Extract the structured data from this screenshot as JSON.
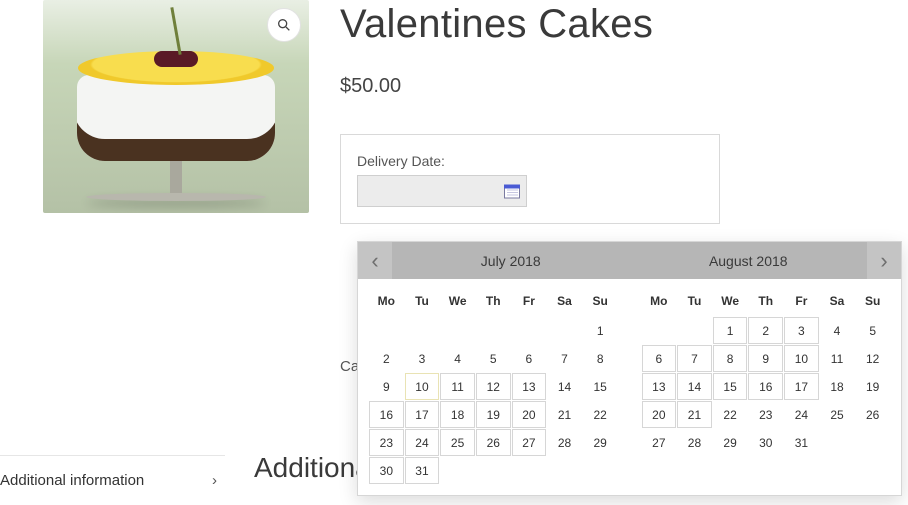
{
  "product": {
    "title": "Valentines Cakes",
    "price": "$50.00"
  },
  "sidebar_tab": {
    "label": "Additional information"
  },
  "category_label": "Cat",
  "additional_heading": "Additional",
  "delivery": {
    "label": "Delivery Date:",
    "value": ""
  },
  "calendar": {
    "months": [
      {
        "title": "July 2018",
        "headers": [
          "Mo",
          "Tu",
          "We",
          "Th",
          "Fr",
          "Sa",
          "Su"
        ],
        "weeks": [
          [
            null,
            null,
            null,
            null,
            null,
            null,
            {
              "d": 1,
              "state": "dis"
            }
          ],
          [
            {
              "d": 2,
              "state": "dis"
            },
            {
              "d": 3,
              "state": "dis"
            },
            {
              "d": 4,
              "state": "dis"
            },
            {
              "d": 5,
              "state": "dis"
            },
            {
              "d": 6,
              "state": "dis"
            },
            {
              "d": 7,
              "state": "dis"
            },
            {
              "d": 8,
              "state": "dis"
            }
          ],
          [
            {
              "d": 9,
              "state": "dis"
            },
            {
              "d": 10,
              "state": "today"
            },
            {
              "d": 11,
              "state": "avail"
            },
            {
              "d": 12,
              "state": "avail"
            },
            {
              "d": 13,
              "state": "avail"
            },
            {
              "d": 14,
              "state": "dis"
            },
            {
              "d": 15,
              "state": "dis"
            }
          ],
          [
            {
              "d": 16,
              "state": "avail"
            },
            {
              "d": 17,
              "state": "avail"
            },
            {
              "d": 18,
              "state": "avail"
            },
            {
              "d": 19,
              "state": "avail"
            },
            {
              "d": 20,
              "state": "avail"
            },
            {
              "d": 21,
              "state": "dis"
            },
            {
              "d": 22,
              "state": "dis"
            }
          ],
          [
            {
              "d": 23,
              "state": "avail"
            },
            {
              "d": 24,
              "state": "avail"
            },
            {
              "d": 25,
              "state": "avail"
            },
            {
              "d": 26,
              "state": "avail"
            },
            {
              "d": 27,
              "state": "avail"
            },
            {
              "d": 28,
              "state": "dis"
            },
            {
              "d": 29,
              "state": "dis"
            }
          ],
          [
            {
              "d": 30,
              "state": "avail"
            },
            {
              "d": 31,
              "state": "avail"
            },
            null,
            null,
            null,
            null,
            null
          ]
        ]
      },
      {
        "title": "August 2018",
        "headers": [
          "Mo",
          "Tu",
          "We",
          "Th",
          "Fr",
          "Sa",
          "Su"
        ],
        "weeks": [
          [
            null,
            null,
            {
              "d": 1,
              "state": "avail"
            },
            {
              "d": 2,
              "state": "avail"
            },
            {
              "d": 3,
              "state": "avail"
            },
            {
              "d": 4,
              "state": "dis"
            },
            {
              "d": 5,
              "state": "dis"
            }
          ],
          [
            {
              "d": 6,
              "state": "avail"
            },
            {
              "d": 7,
              "state": "avail"
            },
            {
              "d": 8,
              "state": "avail"
            },
            {
              "d": 9,
              "state": "avail"
            },
            {
              "d": 10,
              "state": "avail"
            },
            {
              "d": 11,
              "state": "dis"
            },
            {
              "d": 12,
              "state": "dis"
            }
          ],
          [
            {
              "d": 13,
              "state": "avail"
            },
            {
              "d": 14,
              "state": "avail"
            },
            {
              "d": 15,
              "state": "avail"
            },
            {
              "d": 16,
              "state": "avail"
            },
            {
              "d": 17,
              "state": "avail"
            },
            {
              "d": 18,
              "state": "dis"
            },
            {
              "d": 19,
              "state": "dis"
            }
          ],
          [
            {
              "d": 20,
              "state": "avail"
            },
            {
              "d": 21,
              "state": "avail"
            },
            {
              "d": 22,
              "state": "dis"
            },
            {
              "d": 23,
              "state": "dis"
            },
            {
              "d": 24,
              "state": "dis"
            },
            {
              "d": 25,
              "state": "dis"
            },
            {
              "d": 26,
              "state": "dis"
            }
          ],
          [
            {
              "d": 27,
              "state": "dis"
            },
            {
              "d": 28,
              "state": "dis"
            },
            {
              "d": 29,
              "state": "dis"
            },
            {
              "d": 30,
              "state": "dis"
            },
            {
              "d": 31,
              "state": "dis"
            },
            null,
            null
          ]
        ]
      }
    ]
  }
}
